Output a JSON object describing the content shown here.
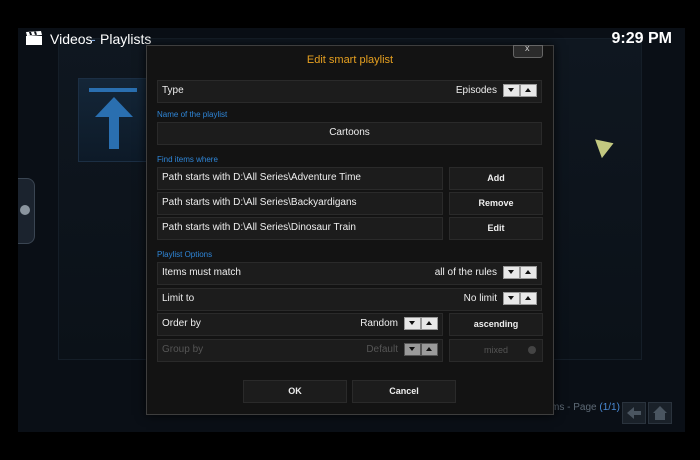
{
  "header": {
    "section": "Videos",
    "separator": "-",
    "subsection": "Playlists",
    "clock": "9:29 PM"
  },
  "footer": {
    "text": "ms - Page",
    "page": "(1/1)"
  },
  "dialog": {
    "title": "Edit smart playlist",
    "close_label": "x",
    "type_label": "Type",
    "type_value": "Episodes",
    "name_section": "Name of the playlist",
    "name_value": "Cartoons",
    "find_section": "Find items where",
    "rules": [
      {
        "text": "Path starts with D:\\All Series\\Adventure Time"
      },
      {
        "text": "Path starts with D:\\All Series\\Backyardigans"
      },
      {
        "text": "Path starts with D:\\All Series\\Dinosaur Train"
      }
    ],
    "rule_buttons": {
      "add": "Add",
      "remove": "Remove",
      "edit": "Edit"
    },
    "options_section": "Playlist Options",
    "match": {
      "label": "Items must match",
      "value": "all of the rules"
    },
    "limit": {
      "label": "Limit to",
      "value": "No limit"
    },
    "order": {
      "label": "Order by",
      "value": "Random",
      "direction": "ascending"
    },
    "group": {
      "label": "Group by",
      "value": "Default",
      "mixed": "mixed"
    },
    "ok_label": "OK",
    "cancel_label": "Cancel"
  },
  "icons": {
    "header": "clapperboard-icon",
    "side": "side-menu-icon",
    "thumb": "up-arrow-icon"
  },
  "colors": {
    "accent_blue": "#2f86d8",
    "title_orange": "#e6a020"
  }
}
